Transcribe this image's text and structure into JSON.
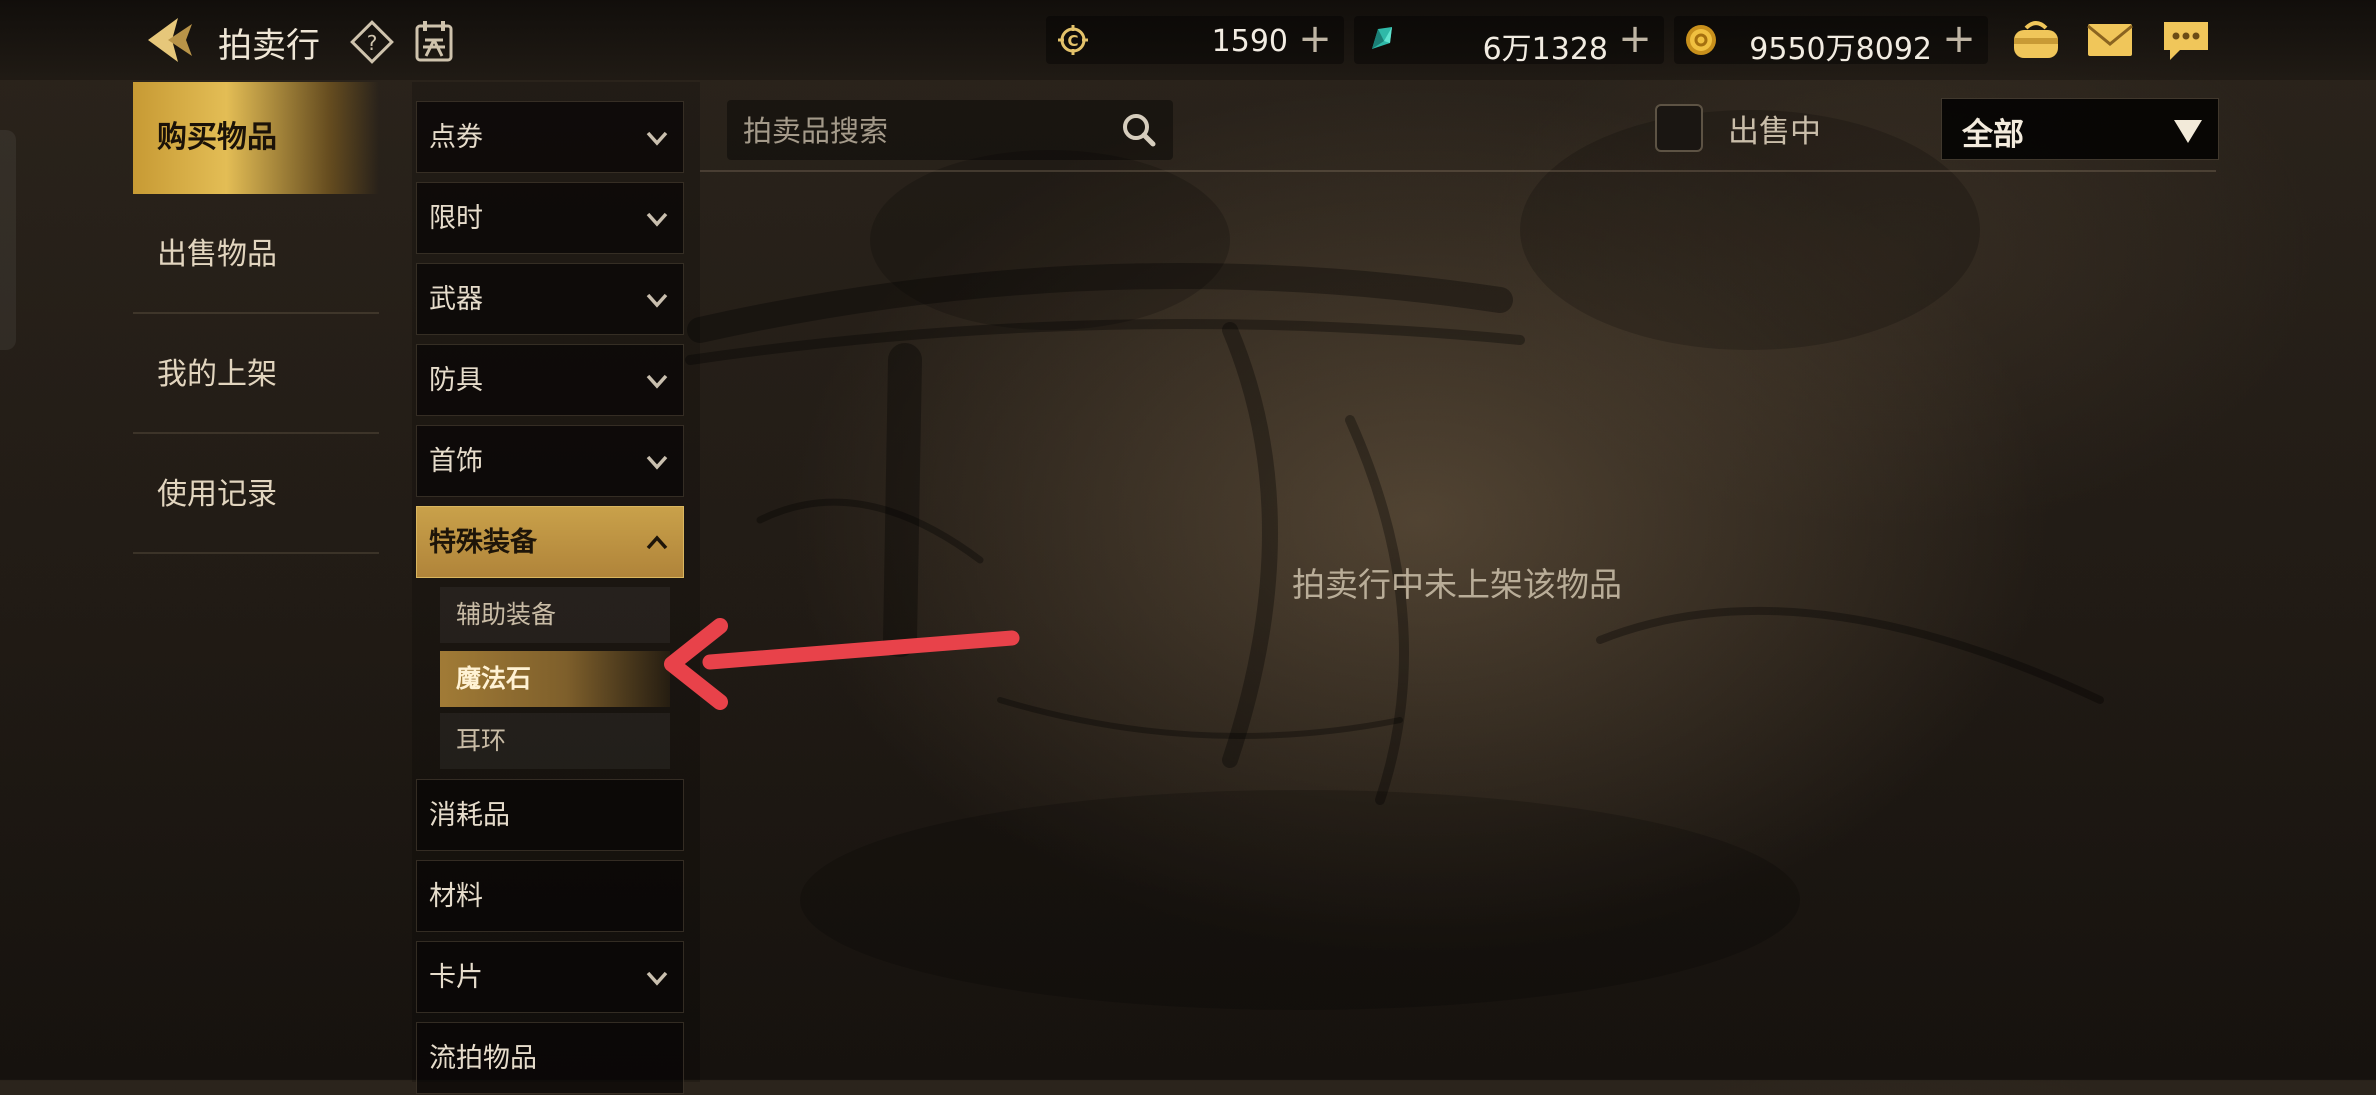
{
  "header": {
    "title": "拍卖行",
    "icons": {
      "back": "back-arrow-icon",
      "help": "help-icon",
      "calendar": "calendar-icon"
    },
    "currencies": [
      {
        "icon": "coupon-currency-icon",
        "value": "1590",
        "plus": "+"
      },
      {
        "icon": "crystal-gem-icon",
        "value": "6万1328",
        "plus": "+"
      },
      {
        "icon": "gold-coin-icon",
        "value": "9550万8092",
        "plus": "+"
      }
    ],
    "right_icons": [
      "bag-icon",
      "mail-icon",
      "chat-icon"
    ]
  },
  "nav": {
    "items": [
      {
        "label": "购买物品",
        "active": true
      },
      {
        "label": "出售物品",
        "active": false
      },
      {
        "label": "我的上架",
        "active": false
      },
      {
        "label": "使用记录",
        "active": false
      }
    ]
  },
  "categories": {
    "items": [
      {
        "label": "点券"
      },
      {
        "label": "限时"
      },
      {
        "label": "武器"
      },
      {
        "label": "防具"
      },
      {
        "label": "首饰"
      },
      {
        "label": "特殊装备"
      },
      {
        "label": "消耗品"
      },
      {
        "label": "材料"
      },
      {
        "label": "卡片"
      },
      {
        "label": "流拍物品"
      }
    ],
    "subitems": [
      {
        "label": "辅助装备"
      },
      {
        "label": "魔法石"
      },
      {
        "label": "耳环"
      }
    ]
  },
  "search": {
    "placeholder": "拍卖品搜索"
  },
  "filter": {
    "onsale_label": "出售中",
    "dropdown_value": "全部"
  },
  "main": {
    "empty_message": "拍卖行中未上架该物品"
  },
  "colors": {
    "accent_gold": "#c9a14a",
    "annotation_arrow": "#e8424a"
  }
}
